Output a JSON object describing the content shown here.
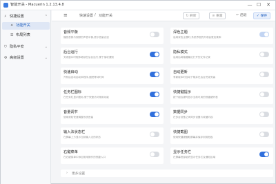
{
  "window": {
    "title": "智能开关 - Macuerin 1.2.13.4.8",
    "minimize": "—",
    "maximize": "☐",
    "close": "✕"
  },
  "sidebar": {
    "items": [
      {
        "label": "快捷设置",
        "icon": "lightning-icon",
        "glyph": "⚡",
        "chevron": "⌃"
      },
      {
        "label": "功能开关",
        "icon": "star-icon",
        "glyph": "✦"
      },
      {
        "label": "布局列表",
        "icon": "list-icon",
        "glyph": "☰"
      },
      {
        "label": "隐私平安",
        "icon": "shield-icon",
        "glyph": "⛉",
        "chevron": "⌄"
      },
      {
        "label": "高级设置",
        "icon": "gear-icon",
        "glyph": "⚙",
        "chevron": "⌄"
      }
    ]
  },
  "toolbar": {
    "menu_glyph": "≡",
    "breadcrumb_home": "快速设置",
    "breadcrumb_sep": "/",
    "breadcrumb_current": "功能开关",
    "buttons": {
      "refresh": "↻ 刷新",
      "reset": "⊘ 重置",
      "back": "← 后退",
      "save": "✓ 保存"
    }
  },
  "cards": [
    {
      "title": "音频平衡",
      "desc": "播放音频与视频的声音平衡,提示音量合适",
      "state": "off"
    },
    {
      "title": "深色主题",
      "desc": "启用深色主题时,系统界面的外观会更加柔和",
      "state": "disabled"
    },
    {
      "title": "后台运行",
      "desc": "关闭窗口时程序继续在后台运行,便于接收通知",
      "state": "on"
    },
    {
      "title": "隐私模式",
      "desc": "启用后将隐藏最近打开的文件记录",
      "state": "off"
    },
    {
      "title": "快速启动",
      "desc": "开机后自动启动本程序,缩短等待时间",
      "state": "on"
    },
    {
      "title": "自动更新",
      "desc": "有新版本时自动下载并在后台完成安装",
      "state": "off"
    },
    {
      "title": "任务栏图标",
      "desc": "在任务栏显示图标,便于快速访问常用功能",
      "state": "on"
    },
    {
      "title": "快捷键提示",
      "desc": "按下组合键时显示当前可用的快捷键列表",
      "state": "off"
    },
    {
      "title": "音量调节",
      "desc": "使用滚轮快速调整系统音量",
      "state": "on"
    },
    {
      "title": "数据同步",
      "desc": "在多台设备之间同步设置与收藏内容",
      "state": "off"
    },
    {
      "title": "输入法状态栏",
      "desc": "在屏幕上方显示当前输入法的状态",
      "state": "off"
    },
    {
      "title": "快捷截图",
      "desc": "使用快捷键截取屏幕并保存到剪贴板",
      "state": "off"
    },
    {
      "title": "右键菜单",
      "desc": "在右键菜单中添加常用操作的快捷入口",
      "state": "off"
    },
    {
      "title": "显示任务栏",
      "desc": "在屏幕底部始终显示任务栏及通知区域",
      "state": "on"
    }
  ],
  "more": {
    "chevron": "›",
    "label": "更多设置"
  },
  "colors": {
    "accent": "#2f6fdc",
    "toggle_off": "#d9dce1",
    "active_nav_bg": "#dfe7f5"
  }
}
